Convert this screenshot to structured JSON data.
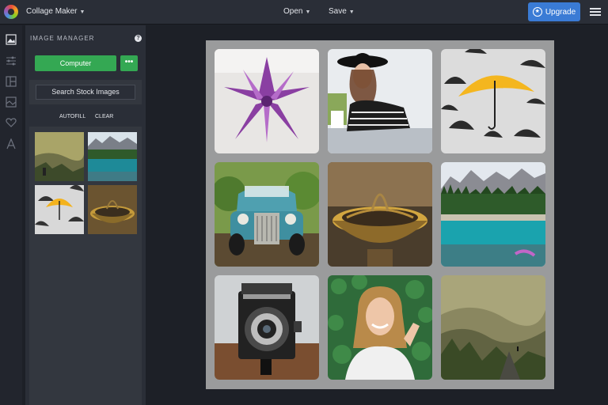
{
  "topbar": {
    "app_name": "Collage Maker",
    "open_label": "Open",
    "save_label": "Save",
    "upgrade_label": "Upgrade"
  },
  "sidebar_icons": [
    "image-icon",
    "sliders-icon",
    "layout-icon",
    "background-icon",
    "heart-icon",
    "text-icon"
  ],
  "panel": {
    "title": "IMAGE MANAGER",
    "help": "?",
    "computer_label": "Computer",
    "more_label": "•••",
    "search_label": "Search Stock Images",
    "autofill_label": "AUTOFILL",
    "clear_label": "CLEAR"
  },
  "thumbnails": [
    "hills-sunset",
    "mountain-lake",
    "yellow-umbrella",
    "golden-bowl"
  ],
  "collage": [
    "purple-succulent",
    "woman-in-hat",
    "yellow-umbrella",
    "vintage-truck",
    "golden-bowl",
    "mountain-lake",
    "vintage-camera",
    "smiling-woman",
    "hills-sunset"
  ],
  "colors": {
    "accent_green": "#34a853",
    "upgrade_blue": "#3a7bd5",
    "canvas_gray": "#9a9b9c"
  }
}
